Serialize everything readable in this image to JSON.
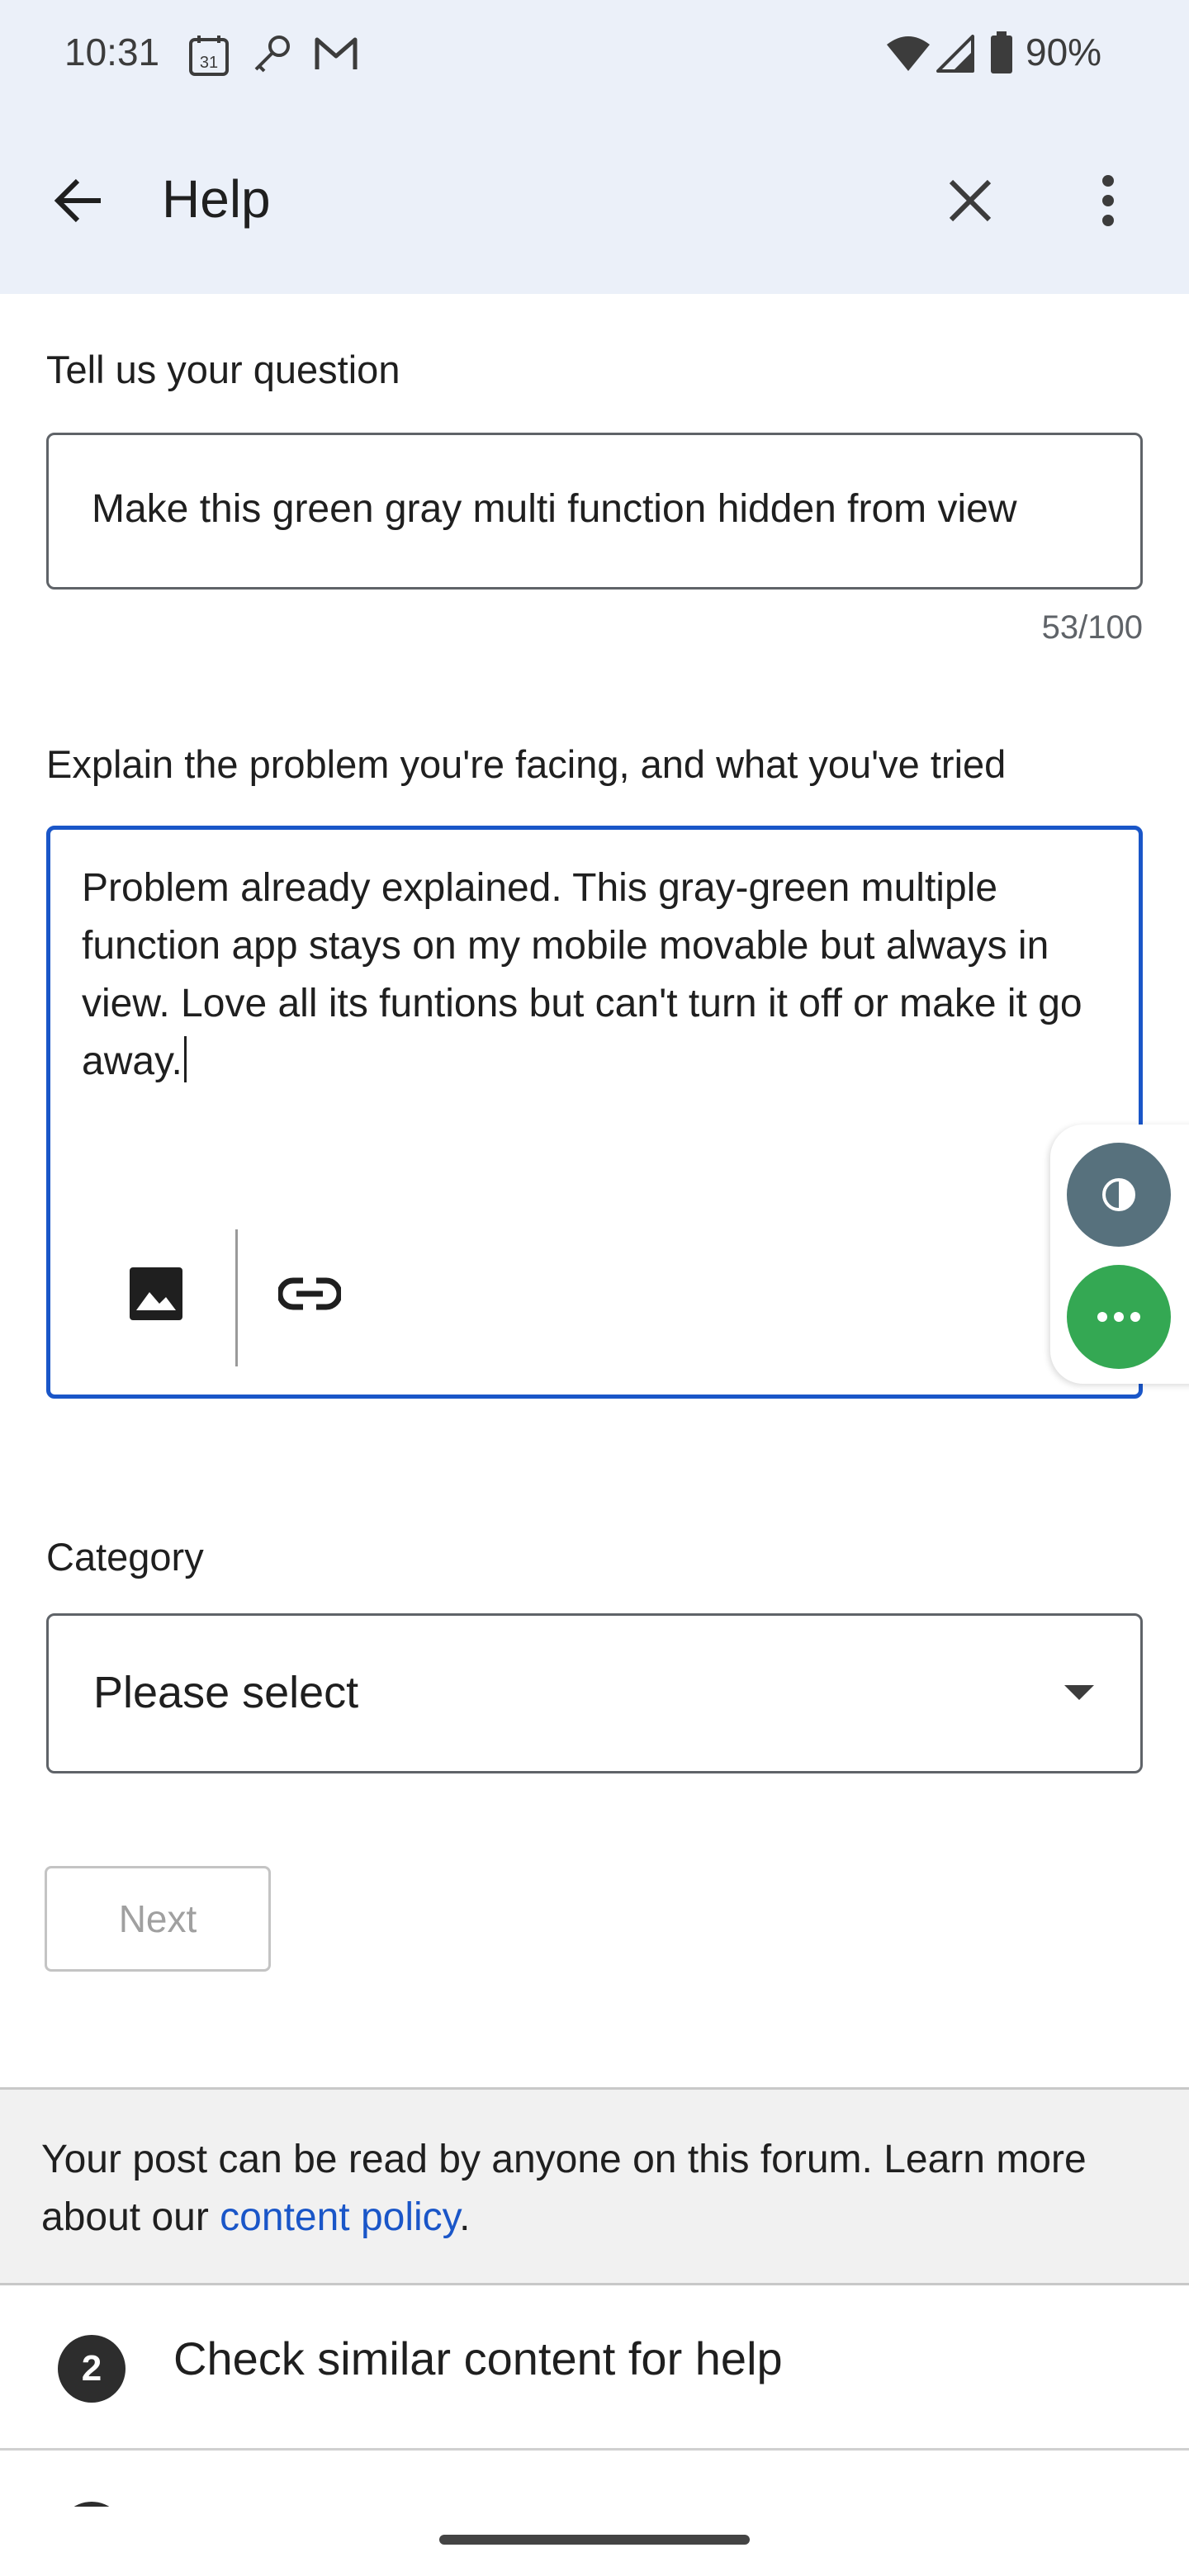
{
  "status_bar": {
    "time": "10:31",
    "calendar_day": "31",
    "battery": "90%",
    "icons": [
      "calendar-icon",
      "key-icon",
      "gmail-icon",
      "wifi-icon",
      "signal-icon",
      "battery-icon"
    ]
  },
  "app_bar": {
    "title": "Help",
    "icons": [
      "back-arrow-icon",
      "close-icon",
      "more-vert-icon"
    ]
  },
  "form": {
    "question_label": "Tell us your question",
    "question_value": "Make this green gray multi function hidden from view",
    "question_counter": "53/100",
    "description_label": "Explain the problem you're facing, and what you've tried",
    "description_value": "Problem already explained. This gray-green multiple function app stays on my mobile movable but always in view. Love all its funtions but can't turn it off or make it go away.",
    "toolbar_icons": [
      "image-icon",
      "link-icon"
    ],
    "category_label": "Category",
    "category_value": "Please select",
    "next_label": "Next"
  },
  "notice": {
    "text_before": "Your post can be read by anyone on this forum. Learn more about our ",
    "link_text": "content policy",
    "text_after": "."
  },
  "steps": [
    {
      "number": "2",
      "title": "Check similar content for help"
    }
  ],
  "colors": {
    "accent": "#1a56c8",
    "header_bg": "#ebf0f9",
    "fab_gray": "#57717d",
    "fab_green": "#34a853"
  }
}
